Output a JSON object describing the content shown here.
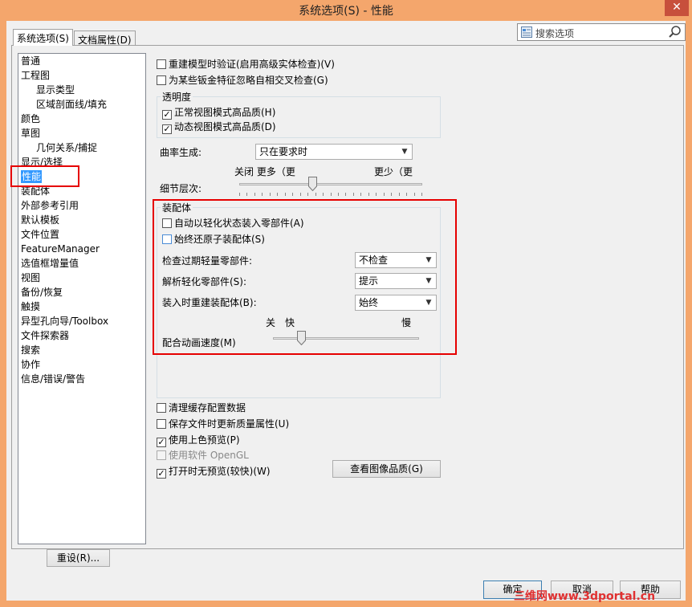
{
  "window": {
    "title": "系统选项(S) - 性能",
    "close_glyph": "✕"
  },
  "tabs": [
    {
      "label": "系统选项(S)",
      "active": true
    },
    {
      "label": "文档属性(D)",
      "active": false
    }
  ],
  "search": {
    "placeholder": "搜索选项",
    "icon": "search-icon"
  },
  "tree": {
    "items": [
      {
        "label": "普通",
        "level": 0
      },
      {
        "label": "工程图",
        "level": 0
      },
      {
        "label": "显示类型",
        "level": 1
      },
      {
        "label": "区域剖面线/填充",
        "level": 1
      },
      {
        "label": "颜色",
        "level": 0
      },
      {
        "label": "草图",
        "level": 0
      },
      {
        "label": "几何关系/捕捉",
        "level": 1
      },
      {
        "label": "显示/选择",
        "level": 0
      },
      {
        "label": "性能",
        "level": 0,
        "selected": true
      },
      {
        "label": "装配体",
        "level": 0
      },
      {
        "label": "外部参考引用",
        "level": 0
      },
      {
        "label": "默认模板",
        "level": 0
      },
      {
        "label": "文件位置",
        "level": 0
      },
      {
        "label": "FeatureManager",
        "level": 0
      },
      {
        "label": "选值框增量值",
        "level": 0
      },
      {
        "label": "视图",
        "level": 0
      },
      {
        "label": "备份/恢复",
        "level": 0
      },
      {
        "label": "触摸",
        "level": 0
      },
      {
        "label": "异型孔向导/Toolbox",
        "level": 0
      },
      {
        "label": "文件探索器",
        "level": 0
      },
      {
        "label": "搜索",
        "level": 0
      },
      {
        "label": "协作",
        "level": 0
      },
      {
        "label": "信息/错误/警告",
        "level": 0
      }
    ],
    "reset_label": "重设(R)..."
  },
  "performance": {
    "top_options": [
      {
        "label": "重建模型时验证(启用高级实体检查)(V)",
        "checked": false
      },
      {
        "label": "为某些钣金特征忽略自相交叉检查(G)",
        "checked": false
      }
    ],
    "transparency": {
      "title": "透明度",
      "options": [
        {
          "label": "正常视图模式高品质(H)",
          "checked": true
        },
        {
          "label": "动态视图模式高品质(D)",
          "checked": true
        }
      ]
    },
    "curvature": {
      "label": "曲率生成:",
      "value": "只在要求时"
    },
    "detail": {
      "label": "细节层次:",
      "left_label": "关闭 更多（更",
      "right_label": "更少（更",
      "level": 0.4
    },
    "assembly": {
      "title": "装配体",
      "options": [
        {
          "label": "自动以轻化状态装入零部件(A)",
          "checked": false
        },
        {
          "label": "始终还原子装配体(S)",
          "checked": false
        }
      ],
      "settings": [
        {
          "label": "检查过期轻量零部件:",
          "value": "不检查"
        },
        {
          "label": "解析轻化零部件(S):",
          "value": "提示"
        },
        {
          "label": "装入时重建装配体(B):",
          "value": "始终"
        }
      ],
      "animation": {
        "label": "配合动画速度(M)",
        "off_label": "关",
        "fast_label": "快",
        "slow_label": "慢",
        "level": 0.19
      }
    },
    "bottom_options": [
      {
        "label": "清理缓存配置数据",
        "checked": false,
        "disabled": false
      },
      {
        "label": "保存文件时更新质量属性(U)",
        "checked": false,
        "disabled": false
      },
      {
        "label": "使用上色预览(P)",
        "checked": true,
        "disabled": false
      },
      {
        "label": "使用软件 OpenGL",
        "checked": false,
        "disabled": true
      },
      {
        "label": "打开时无预览(较快)(W)",
        "checked": true,
        "disabled": false
      }
    ],
    "image_quality_button": "查看图像品质(G)"
  },
  "footer": {
    "ok": "确定",
    "cancel": "取消",
    "help": "帮助"
  },
  "watermark": "三维网www.3dportal.cn",
  "colors": {
    "selection": "#3399ff",
    "highlight_box": "#e60000",
    "titlebar": "#f4a66c"
  }
}
